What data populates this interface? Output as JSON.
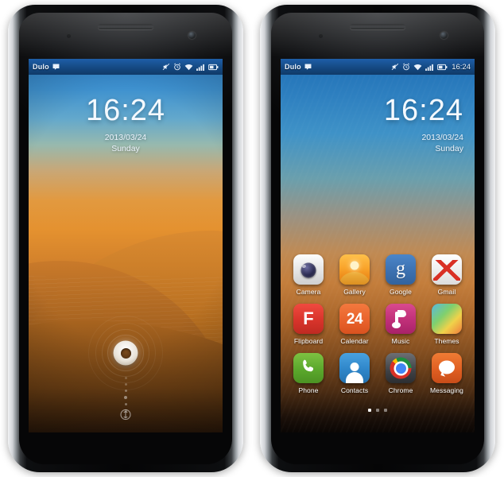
{
  "statusbar": {
    "carrier": "Dulo",
    "time": "16:24",
    "icons": [
      "message-icon",
      "silent-mode-icon",
      "alarm-icon",
      "wifi-icon",
      "signal-icon",
      "battery-icon"
    ]
  },
  "lockscreen": {
    "time": "16:24",
    "date": "2013/03/24",
    "day": "Sunday",
    "unlock_control": "unlock-ring",
    "lock_glyph": "lock-icon"
  },
  "homescreen": {
    "time": "16:24",
    "date": "2013/03/24",
    "day": "Sunday",
    "page_indicator": {
      "count": 3,
      "active": 1
    },
    "rows": [
      [
        {
          "label": "Camera",
          "icon": "camera-icon"
        },
        {
          "label": "Gallery",
          "icon": "gallery-icon"
        },
        {
          "label": "Google",
          "icon": "google-icon",
          "glyph": "g"
        },
        {
          "label": "Gmail",
          "icon": "gmail-icon"
        }
      ],
      [
        {
          "label": "Flipboard",
          "icon": "flipboard-icon",
          "glyph": "F"
        },
        {
          "label": "Calendar",
          "icon": "calendar-icon",
          "glyph": "24"
        },
        {
          "label": "Music",
          "icon": "music-icon"
        },
        {
          "label": "Themes",
          "icon": "themes-icon"
        }
      ],
      [
        {
          "label": "Phone",
          "icon": "phone-icon"
        },
        {
          "label": "Contacts",
          "icon": "contacts-icon"
        },
        {
          "label": "Chrome",
          "icon": "chrome-icon"
        },
        {
          "label": "Messaging",
          "icon": "messaging-icon"
        }
      ]
    ]
  },
  "colors": {
    "statusbar_blue": "#14477f",
    "wallpaper_sky": "#2f7fc4",
    "wallpaper_sand": "#e4912f",
    "label_text": "#ffffff"
  }
}
